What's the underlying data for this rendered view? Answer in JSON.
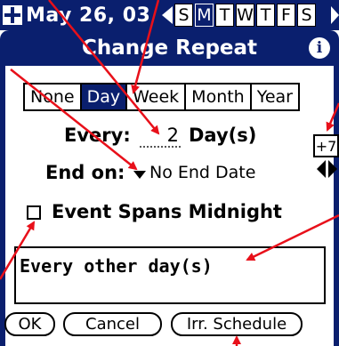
{
  "datebar": {
    "date": "May 26, 03",
    "weekdays": [
      {
        "label": "S",
        "selected": false
      },
      {
        "label": "M",
        "selected": true
      },
      {
        "label": "T",
        "selected": false
      },
      {
        "label": "W",
        "selected": false
      },
      {
        "label": "T",
        "selected": false
      },
      {
        "label": "F",
        "selected": false
      },
      {
        "label": "S",
        "selected": false
      }
    ]
  },
  "dialog": {
    "title": "Change Repeat",
    "info_icon": "i"
  },
  "tabs": [
    {
      "label": "None",
      "selected": false
    },
    {
      "label": "Day",
      "selected": true
    },
    {
      "label": "Week",
      "selected": false
    },
    {
      "label": "Month",
      "selected": false
    },
    {
      "label": "Year",
      "selected": false
    }
  ],
  "every": {
    "label": "Every:",
    "value": "2",
    "unit": "Day(s)",
    "step_button": "+7"
  },
  "end_on": {
    "label": "End on:",
    "value": "No End Date"
  },
  "span_midnight": {
    "label": "Event Spans Midnight",
    "checked": false
  },
  "description": "Every other day(s)",
  "buttons": {
    "ok": "OK",
    "cancel": "Cancel",
    "irregular": "Irr. Schedule"
  },
  "colors": {
    "header": "#0a1f6e",
    "annotation": "#e8101a"
  }
}
